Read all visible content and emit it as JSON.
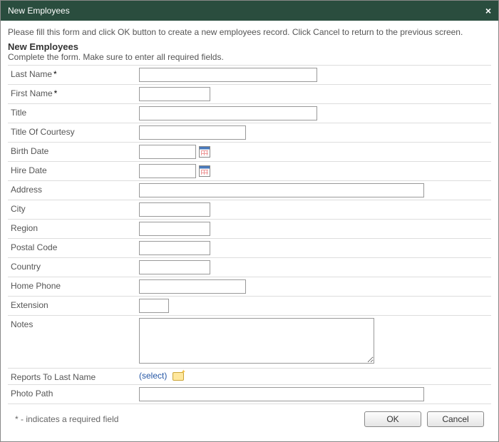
{
  "dialog": {
    "title": "New Employees",
    "close_label": "×"
  },
  "instructions": "Please fill this form and click OK button to create a new employees record. Click Cancel to return to the previous screen.",
  "section": {
    "header": "New Employees",
    "sub": "Complete the form. Make sure to enter all required fields."
  },
  "fields": {
    "last_name": {
      "label": "Last Name",
      "required": true,
      "value": ""
    },
    "first_name": {
      "label": "First Name",
      "required": true,
      "value": ""
    },
    "title": {
      "label": "Title",
      "value": ""
    },
    "title_of_courtesy": {
      "label": "Title Of Courtesy",
      "value": ""
    },
    "birth_date": {
      "label": "Birth Date",
      "value": ""
    },
    "hire_date": {
      "label": "Hire Date",
      "value": ""
    },
    "address": {
      "label": "Address",
      "value": ""
    },
    "city": {
      "label": "City",
      "value": ""
    },
    "region": {
      "label": "Region",
      "value": ""
    },
    "postal_code": {
      "label": "Postal Code",
      "value": ""
    },
    "country": {
      "label": "Country",
      "value": ""
    },
    "home_phone": {
      "label": "Home Phone",
      "value": ""
    },
    "extension": {
      "label": "Extension",
      "value": ""
    },
    "notes": {
      "label": "Notes",
      "value": ""
    },
    "reports_to": {
      "label": "Reports To Last Name",
      "select_text": "(select)"
    },
    "photo_path": {
      "label": "Photo Path",
      "value": ""
    }
  },
  "footer": {
    "note": "* - indicates a required field",
    "ok": "OK",
    "cancel": "Cancel"
  },
  "required_marker": "*"
}
